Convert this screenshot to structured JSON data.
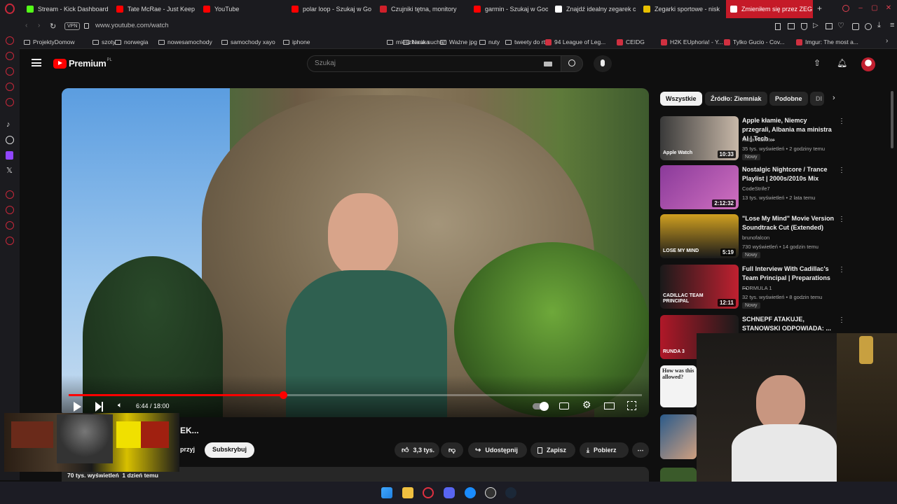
{
  "tabs": [
    {
      "label": "Stream - Kick Dashboard",
      "color": "#53fc18"
    },
    {
      "label": "Tate McRae - Just Keep",
      "color": "#ff0000"
    },
    {
      "label": "YouTube",
      "color": "#ff0000"
    },
    {
      "label": "polar loop - Szukaj w Go",
      "color": "#ff0000"
    },
    {
      "label": "Czujniki tętna, monitory",
      "color": "#d0202a"
    },
    {
      "label": "garmin - Szukaj w Googl",
      "color": "#ff0000"
    },
    {
      "label": "Znajdź idealny zegarek c",
      "color": "#ffffff"
    },
    {
      "label": "Zegarki sportowe - nisk",
      "color": "#e8c000"
    },
    {
      "label": "Zmieniłem się przez ZEG",
      "color": "#ffffff"
    }
  ],
  "address": {
    "vpn": "VPN",
    "url": "www.youtube.com/watch"
  },
  "bookmarks": [
    {
      "label": "ProjektyDomow",
      "type": "folder"
    },
    {
      "label": "szoty",
      "type": "folder"
    },
    {
      "label": "norwegia",
      "type": "folder"
    },
    {
      "label": "nowesamochody",
      "type": "folder"
    },
    {
      "label": "samochody xayo",
      "type": "folder"
    },
    {
      "label": "iphone",
      "type": "folder"
    },
    {
      "label": "mieszkania suchar",
      "type": "folder"
    },
    {
      "label": "Nauka",
      "type": "folder"
    },
    {
      "label": "Ważne jpg",
      "type": "folder"
    },
    {
      "label": "nuty",
      "type": "folder"
    },
    {
      "label": "tweety do rt",
      "type": "folder"
    },
    {
      "label": "94 League of Leg...",
      "type": "site"
    },
    {
      "label": "CEIDG",
      "type": "site"
    },
    {
      "label": "H2K EUphoria! - Y...",
      "type": "site"
    },
    {
      "label": "Tylko Gucio - Cov...",
      "type": "site"
    },
    {
      "label": "Imgur: The most a...",
      "type": "site"
    }
  ],
  "youtube": {
    "logo": "Premium",
    "logo_badge": "PL",
    "search_placeholder": "Szukaj"
  },
  "player": {
    "time": "6:44 / 18:00",
    "progress": 0.374,
    "title_fragment": "EK...",
    "views_meta": "70 tys. wyświetleń  1 dzień temu"
  },
  "actions": {
    "join_fragment": "przyj",
    "subscribe": "Subskrybuj",
    "likes": "3,3 tys.",
    "share": "Udostępnij",
    "save": "Zapisz",
    "download": "Pobierz"
  },
  "chips": [
    "Wszystkie",
    "Źródło: Ziemniak",
    "Podobne",
    "Dl"
  ],
  "recommendations": [
    {
      "title": "Apple kłamie, Niemcy przegrali, Albania ma ministra AI | Tech ...",
      "channel": "Kuba Klawiter",
      "meta": "35 tys. wyświetleń • 2 godziny temu",
      "badge": "Nowy",
      "duration": "10:33"
    },
    {
      "title": "Nostalgic Nightcore / Trance Playlist | 2000s/2010s Mix",
      "channel": "CodeStrife7",
      "meta": "13 tys. wyświetleń • 2 lata temu",
      "badge": "",
      "duration": "2:12:32"
    },
    {
      "title": "\"Lose My Mind\" Movie Version Soundtrack Cut (Extended)",
      "channel": "brunofalcon",
      "meta": "730 wyświetleń • 14 godzin temu",
      "badge": "Nowy",
      "duration": "5:19"
    },
    {
      "title": "Full Interview With Cadillac's Team Principal | Preparations ...",
      "channel": "FORMULA 1",
      "meta": "32 tys. wyświetleń • 8 godzin temu",
      "badge": "Nowy",
      "duration": "12:11"
    },
    {
      "title": "SCHNEPF ATAKUJE, STANOWSKI ODPOWIADA: ...",
      "channel": "",
      "meta": "",
      "badge": "",
      "duration": ""
    }
  ],
  "thumb_texts": {
    "rec1": "Apple Watch",
    "rec3": "LOSE MY MIND",
    "rec4": "CADILLAC TEAM PRINCIPAL",
    "rec5": "RUNDA 3",
    "rec6": "How was this allowed?"
  },
  "colors": {
    "accent": "#ff0000",
    "tab_active": "#c51a28",
    "bg": "#0f0f0f"
  }
}
